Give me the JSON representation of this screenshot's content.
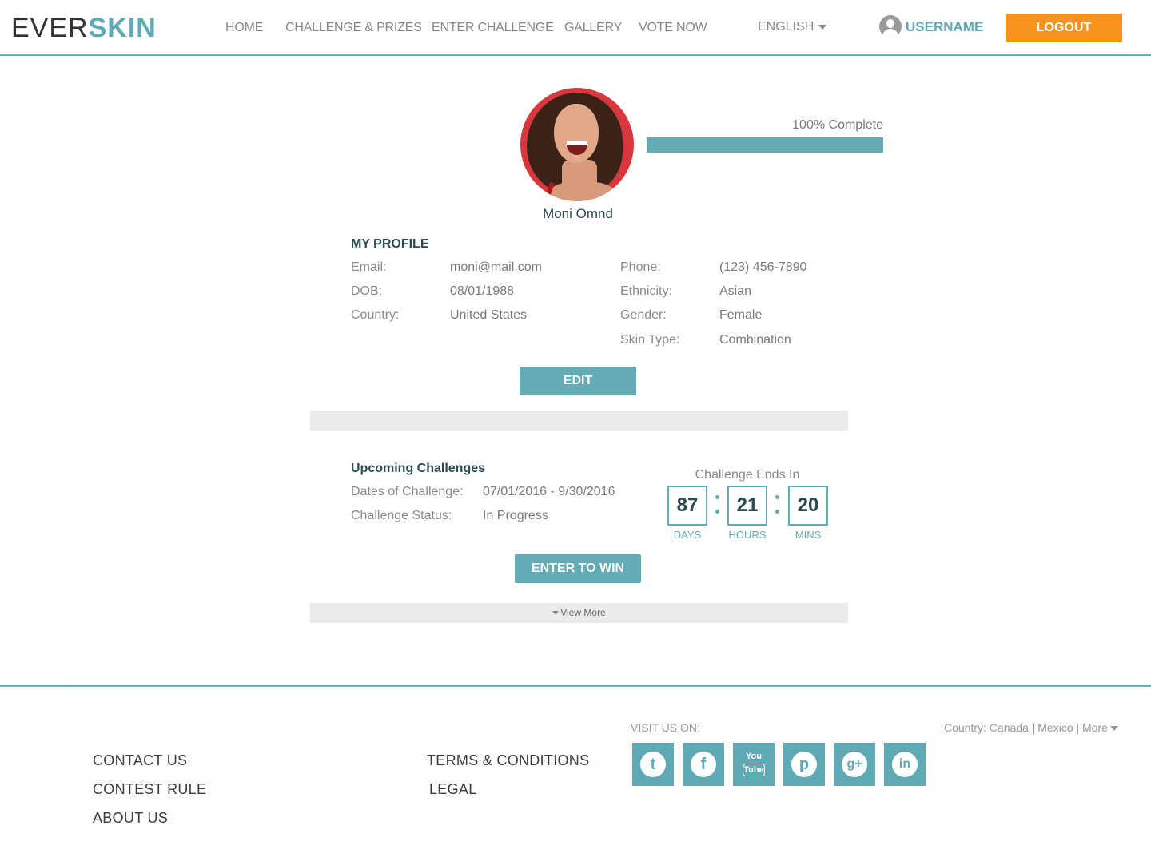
{
  "brand": {
    "part1": "EVER",
    "part2": "SKIN"
  },
  "nav": {
    "items": [
      "HOME",
      "CHALLENGE & PRIZES",
      "ENTER CHALLENGE",
      "GALLERY",
      "VOTE NOW"
    ],
    "language": "ENGLISH",
    "username": "USERNAME",
    "logout": "LOGOUT"
  },
  "profile": {
    "name": "Moni Omnd",
    "progress_label": "100% Complete",
    "progress_percent": 100,
    "section_title": "MY PROFILE",
    "left_fields": [
      {
        "label": "Email:",
        "value": "moni@mail.com"
      },
      {
        "label": "DOB:",
        "value": "08/01/1988"
      },
      {
        "label": "Country:",
        "value": "United States"
      }
    ],
    "right_fields": [
      {
        "label": "Phone:",
        "value": "(123) 456-7890"
      },
      {
        "label": "Ethnicity:",
        "value": "Asian"
      },
      {
        "label": "Gender:",
        "value": "Female"
      },
      {
        "label": "Skin Type:",
        "value": "Combination"
      }
    ],
    "edit_label": "EDIT"
  },
  "challenges": {
    "title": "Upcoming Challenges",
    "fields": [
      {
        "label": "Dates of Challenge:",
        "value": "07/01/2016 - 9/30/2016"
      },
      {
        "label": "Challenge Status:",
        "value": "In Progress"
      }
    ],
    "countdown_title": "Challenge Ends In",
    "countdown": [
      {
        "value": "87",
        "unit": "DAYS"
      },
      {
        "value": "21",
        "unit": "HOURS"
      },
      {
        "value": "20",
        "unit": "MINS"
      }
    ],
    "enter_label": "ENTER TO WIN",
    "view_more": "View More"
  },
  "footer": {
    "col1": [
      "CONTACT US",
      "CONTEST RULE",
      "ABOUT US"
    ],
    "col2": [
      "TERMS & CONDITIONS",
      "LEGAL"
    ],
    "visit_label": "VISIT US ON:",
    "country_label": "Country: Canada | Mexico | More",
    "social": [
      {
        "name": "twitter-icon",
        "glyph": "t"
      },
      {
        "name": "facebook-icon",
        "glyph": "f"
      },
      {
        "name": "youtube-icon",
        "glyph": "You Tube",
        "top": "You",
        "bottom": "Tube"
      },
      {
        "name": "pinterest-icon",
        "glyph": "p"
      },
      {
        "name": "google-plus-icon",
        "glyph": "g+"
      },
      {
        "name": "linkedin-icon",
        "glyph": "in"
      }
    ]
  },
  "colors": {
    "accent": "#64abb6",
    "logout": "#f7941d",
    "title": "#2b4a52"
  }
}
